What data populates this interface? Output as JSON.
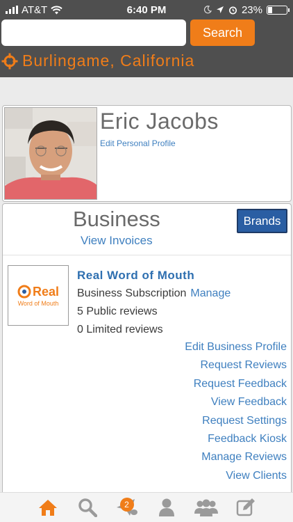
{
  "status_bar": {
    "carrier": "AT&T",
    "time": "6:40 PM",
    "battery": "23%",
    "battery_level": 0.23
  },
  "header": {
    "search": {
      "placeholder": "",
      "value": ""
    },
    "search_button": "Search",
    "location": "Burlingame, California",
    "location_icon": "target-icon"
  },
  "profile": {
    "name": "Eric Jacobs",
    "edit_link": "Edit Personal Profile"
  },
  "business": {
    "title": "Business",
    "invoices_link": "View Invoices",
    "brands_button": "Brands",
    "logo_text": "Real",
    "logo_subtext": "Word of Mouth",
    "name": "Real Word of Mouth",
    "subscription": "Business Subscription",
    "manage_link": "Manage",
    "public_reviews": "5 Public reviews",
    "limited_reviews": "0 Limited reviews",
    "actions": [
      "Edit Business Profile",
      "Request Reviews",
      "Request Feedback",
      "View Feedback",
      "Request Settings",
      "Feedback Kiosk",
      "Manage Reviews",
      "View Clients"
    ]
  },
  "bottom_nav": {
    "items": [
      "home-icon",
      "search-icon",
      "messages-icon",
      "profile-icon",
      "groups-icon",
      "compose-icon"
    ],
    "messages_badge": "2",
    "active_color": "#f07d19",
    "inactive_color": "#9a9a9a"
  },
  "colors": {
    "accent": "#f07d19",
    "header": "#4f4f4f",
    "link": "#3e7fbf",
    "brands_button": "#2a5ea3"
  }
}
